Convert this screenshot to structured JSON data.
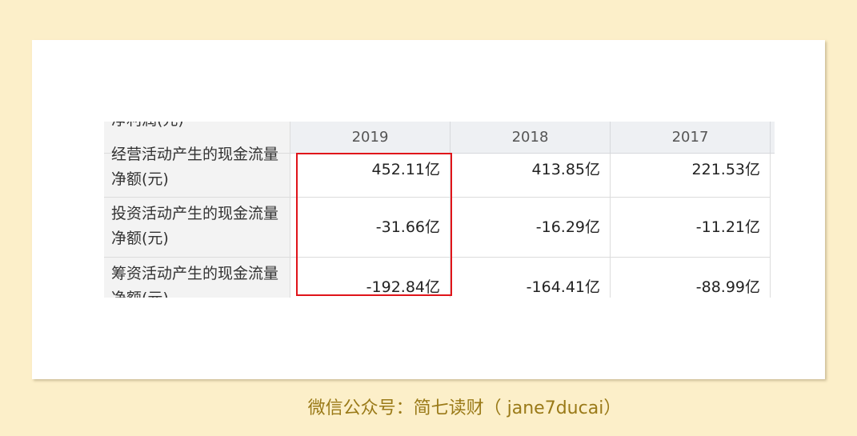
{
  "table": {
    "partial_top_label": "净利润(元)",
    "years": [
      "2019",
      "2018",
      "2017"
    ],
    "rows": [
      {
        "label_line1": "经营活动产生的现金流量",
        "label_line2": "净额(元)",
        "values": [
          "452.11亿",
          "413.85亿",
          "221.53亿"
        ]
      },
      {
        "label_line1": "投资活动产生的现金流量",
        "label_line2": "净额(元)",
        "values": [
          "-31.66亿",
          "-16.29亿",
          "-11.21亿"
        ]
      },
      {
        "label_line1": "筹资活动产生的现金流量",
        "label_line2": "净额(元)",
        "values": [
          "-192.84亿",
          "-164.41亿",
          "-88.99亿"
        ]
      }
    ]
  },
  "highlight": {
    "color": "#e0141a"
  },
  "footer": {
    "credit": "微信公众号：简七读财（ jane7ducai）"
  },
  "colors": {
    "background": "#fcefc9",
    "credit_text": "#9a7a18"
  }
}
